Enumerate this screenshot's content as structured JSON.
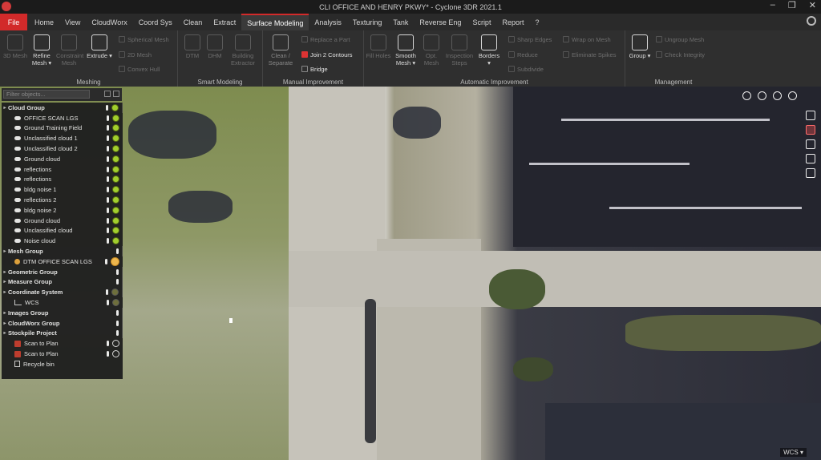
{
  "window": {
    "title": "CLI OFFICE AND HENRY PKWY* - Cyclone 3DR 2021.1",
    "buttons": [
      "–",
      "❐",
      "✕"
    ]
  },
  "menu": {
    "tabs": [
      "File",
      "Home",
      "View",
      "CloudWorx",
      "Coord Sys",
      "Clean",
      "Extract",
      "Surface Modeling",
      "Analysis",
      "Texturing",
      "Tank",
      "Reverse Eng",
      "Script",
      "Report",
      "?"
    ],
    "active": "Surface Modeling"
  },
  "ribbon": {
    "meshing": {
      "label": "Meshing",
      "buttons": [
        "3D Mesh",
        "Refine Mesh ▾",
        "Constraint Mesh",
        "Extrude ▾"
      ],
      "small": [
        "Spherical Mesh",
        "2D Mesh",
        "Convex Hull"
      ]
    },
    "smart_modeling": {
      "label": "Smart Modeling",
      "buttons": [
        "DTM",
        "DHM",
        "Building Extractor"
      ]
    },
    "manual_improvement": {
      "label": "Manual Improvement",
      "buttons": [
        "Clean / Separate"
      ],
      "small": [
        "Replace a Part",
        "Join 2 Contours",
        "Bridge"
      ]
    },
    "automatic_improvement": {
      "label": "Automatic Improvement",
      "buttons": [
        "Fill Holes",
        "Smooth Mesh ▾",
        "Opt. Mesh",
        "Inspection Steps",
        "Borders ▾"
      ],
      "small": [
        "Sharp Edges",
        "Reduce",
        "Subdivide",
        "Wrap on Mesh",
        "Eliminate Spikes"
      ]
    },
    "management": {
      "label": "Management",
      "buttons": [
        "Group ▾"
      ],
      "small": [
        "Ungroup Mesh",
        "Check Integrity"
      ]
    }
  },
  "tree": {
    "filter_placeholder": "Filter objects...",
    "items": [
      {
        "label": "Cloud Group",
        "kind": "group",
        "indicators": "dot"
      },
      {
        "label": "OFFICE SCAN LGS",
        "kind": "cloud",
        "indicators": "dot"
      },
      {
        "label": "Ground Training Field",
        "kind": "cloud",
        "indicators": "dot"
      },
      {
        "label": "Unclassified cloud 1",
        "kind": "cloud",
        "indicators": "dot"
      },
      {
        "label": "Unclassified cloud 2",
        "kind": "cloud",
        "indicators": "dot"
      },
      {
        "label": "Ground cloud",
        "kind": "cloud",
        "indicators": "dot"
      },
      {
        "label": "reflections",
        "kind": "cloud",
        "indicators": "dot"
      },
      {
        "label": "reflections",
        "kind": "cloud",
        "indicators": "dot"
      },
      {
        "label": "bldg noise 1",
        "kind": "cloud",
        "indicators": "dot"
      },
      {
        "label": "reflections 2",
        "kind": "cloud",
        "indicators": "dot"
      },
      {
        "label": "bldg noise 2",
        "kind": "cloud",
        "indicators": "dot"
      },
      {
        "label": "Ground cloud",
        "kind": "cloud",
        "indicators": "dot"
      },
      {
        "label": "Unclassified cloud",
        "kind": "cloud",
        "indicators": "dot"
      },
      {
        "label": "Noise cloud",
        "kind": "cloud",
        "indicators": "dot"
      },
      {
        "label": "Mesh Group",
        "kind": "group",
        "indicators": "pin"
      },
      {
        "label": "DTM OFFICE SCAN LGS",
        "kind": "mesh",
        "indicators": "sun"
      },
      {
        "label": "Geometric Group",
        "kind": "group",
        "indicators": "pin"
      },
      {
        "label": "Measure Group",
        "kind": "group",
        "indicators": "pin"
      },
      {
        "label": "Coordinate System",
        "kind": "group",
        "indicators": "faint"
      },
      {
        "label": "WCS",
        "kind": "wcs",
        "indicators": "faint"
      },
      {
        "label": "Images Group",
        "kind": "group",
        "indicators": "pin"
      },
      {
        "label": "CloudWorx Group",
        "kind": "group",
        "indicators": "pin"
      },
      {
        "label": "Stockpile Project",
        "kind": "group",
        "indicators": "pin"
      },
      {
        "label": "Scan to Plan",
        "kind": "red",
        "indicators": "play"
      },
      {
        "label": "Scan to Plan",
        "kind": "red",
        "indicators": "play"
      },
      {
        "label": "Recycle bin",
        "kind": "bin",
        "indicators": "none"
      }
    ]
  },
  "viewport": {
    "wcs_label": "WCS ▾"
  },
  "colors": {
    "accent": "#d22a2a",
    "ribbon_bg": "#2f2f2f",
    "panel_bg": "#1f1f1f"
  }
}
